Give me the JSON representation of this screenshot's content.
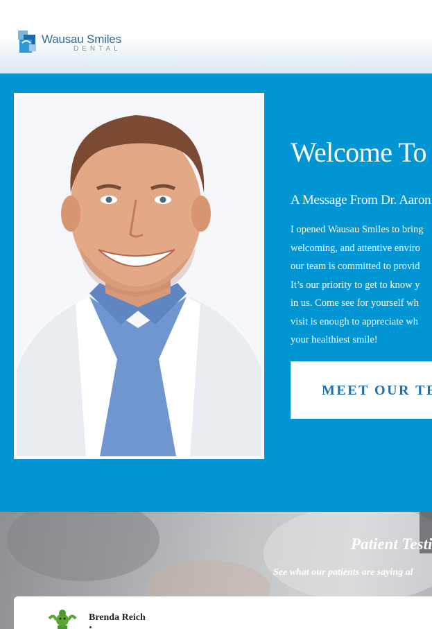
{
  "header": {
    "logo_name": "Wausau Smiles",
    "logo_subtitle": "DENTAL"
  },
  "welcome": {
    "title": "Welcome To",
    "subtitle": "A Message From Dr. Aaron",
    "body_lines": [
      "I opened Wausau Smiles to bring",
      "welcoming, and attentive enviro",
      "our team is committed to provid",
      "It’s our priority to get to know y",
      "in us. Come see for yourself wh",
      "visit is enough to appreciate wh",
      "your healthiest smile!"
    ],
    "team_button": "MEET OUR TEA",
    "photo_alt": "smiling-doctor-photo"
  },
  "testimonials": {
    "title": "Patient Testi",
    "subtitle": "See what our patients are saying al",
    "reviews": [
      {
        "name": "Brenda Reich"
      }
    ]
  },
  "colors": {
    "brand_blue": "#0295d4",
    "button_text": "#1e6fb0",
    "logo_blue": "#2b6a9e"
  }
}
